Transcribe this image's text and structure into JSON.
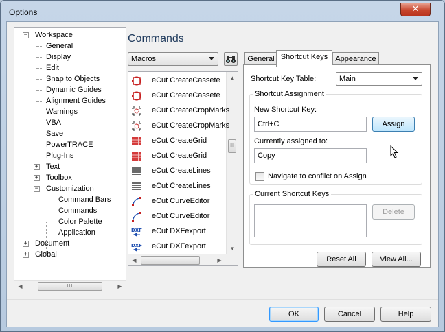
{
  "window": {
    "title": "Options",
    "close_glyph": "✕"
  },
  "tree": {
    "items": [
      {
        "label": "Workspace",
        "level": 0,
        "expander": "−"
      },
      {
        "label": "General",
        "level": 1
      },
      {
        "label": "Display",
        "level": 1
      },
      {
        "label": "Edit",
        "level": 1
      },
      {
        "label": "Snap to Objects",
        "level": 1
      },
      {
        "label": "Dynamic Guides",
        "level": 1
      },
      {
        "label": "Alignment Guides",
        "level": 1
      },
      {
        "label": "Warnings",
        "level": 1
      },
      {
        "label": "VBA",
        "level": 1
      },
      {
        "label": "Save",
        "level": 1
      },
      {
        "label": "PowerTRACE",
        "level": 1
      },
      {
        "label": "Plug-Ins",
        "level": 1
      },
      {
        "label": "Text",
        "level": 1,
        "expander": "+"
      },
      {
        "label": "Toolbox",
        "level": 1,
        "expander": "+"
      },
      {
        "label": "Customization",
        "level": 1,
        "expander": "−"
      },
      {
        "label": "Command Bars",
        "level": 2
      },
      {
        "label": "Commands",
        "level": 2
      },
      {
        "label": "Color Palette",
        "level": 2
      },
      {
        "label": "Application",
        "level": 2
      },
      {
        "label": "Document",
        "level": 0,
        "expander": "+"
      },
      {
        "label": "Global",
        "level": 0,
        "expander": "+"
      }
    ]
  },
  "commands": {
    "title": "Commands",
    "category": "Macros",
    "items": [
      {
        "label": "eCut CreateCassete",
        "icon": "cassete-icon"
      },
      {
        "label": "eCut CreateCassete",
        "icon": "cassete-icon"
      },
      {
        "label": "eCut CreateCropMarks",
        "icon": "crop-marks-icon"
      },
      {
        "label": "eCut CreateCropMarks",
        "icon": "crop-marks-icon"
      },
      {
        "label": "eCut CreateGrid",
        "icon": "grid-icon"
      },
      {
        "label": "eCut CreateGrid",
        "icon": "grid-icon"
      },
      {
        "label": "eCut CreateLines",
        "icon": "lines-icon"
      },
      {
        "label": "eCut CreateLines",
        "icon": "lines-icon"
      },
      {
        "label": "eCut CurveEditor",
        "icon": "curve-icon"
      },
      {
        "label": "eCut CurveEditor",
        "icon": "curve-icon"
      },
      {
        "label": "eCut DXFexport",
        "icon": "dxf-icon"
      },
      {
        "label": "eCut DXFexport",
        "icon": "dxf-icon"
      }
    ]
  },
  "tabs": [
    {
      "label": "General",
      "active": false
    },
    {
      "label": "Shortcut Keys",
      "active": true
    },
    {
      "label": "Appearance",
      "active": false
    }
  ],
  "shortcut": {
    "table_label": "Shortcut Key Table:",
    "table_value": "Main",
    "assignment_group": "Shortcut Assignment",
    "new_key_label": "New Shortcut Key:",
    "new_key_value": "Ctrl+C",
    "assign_button": "Assign",
    "assigned_to_label": "Currently assigned to:",
    "assigned_to_value": "Copy",
    "navigate_label": "Navigate to conflict on Assign",
    "navigate_checked": false,
    "current_group": "Current Shortcut Keys",
    "delete_button": "Delete",
    "reset_button": "Reset All",
    "viewall_button": "View All..."
  },
  "footer": {
    "ok": "OK",
    "cancel": "Cancel",
    "help": "Help"
  },
  "scroll": {
    "left": "◀",
    "right": "▶",
    "up": "▲",
    "down": "▼",
    "grip": "III"
  },
  "icon_text": {
    "dxf": "DXF"
  }
}
